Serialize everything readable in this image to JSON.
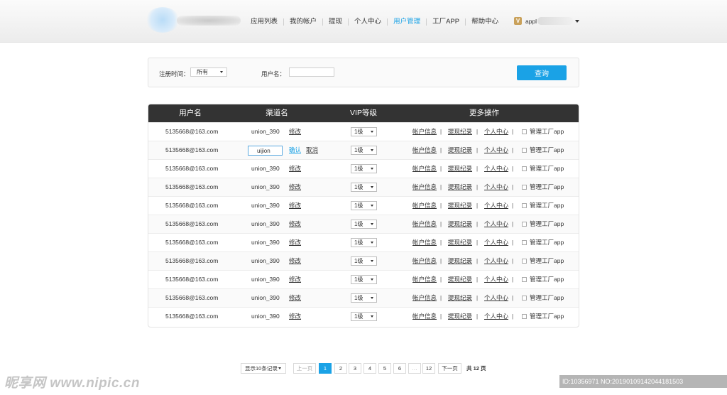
{
  "nav": {
    "items": [
      "应用列表",
      "我的帐户",
      "提现",
      "个人中心",
      "用户管理",
      "工厂APP",
      "帮助中心"
    ],
    "active_index": 4
  },
  "user": {
    "name": "appl"
  },
  "search": {
    "reg_time_label": "注册时间：",
    "reg_time_value": "所有",
    "username_label": "用户名：",
    "username_value": "",
    "query_button": "查询"
  },
  "table": {
    "headers": [
      "用户名",
      "渠道名",
      "VIP等级",
      "更多操作"
    ],
    "rows": [
      {
        "username": "5135668@163.com",
        "channel": "union_390",
        "vip": "1级",
        "editing": false
      },
      {
        "username": "5135668@163.com",
        "channel": "uijion",
        "vip": "1级",
        "editing": true
      },
      {
        "username": "5135668@163.com",
        "channel": "union_390",
        "vip": "1级",
        "editing": false
      },
      {
        "username": "5135668@163.com",
        "channel": "union_390",
        "vip": "1级",
        "editing": false
      },
      {
        "username": "5135668@163.com",
        "channel": "union_390",
        "vip": "1级",
        "editing": false
      },
      {
        "username": "5135668@163.com",
        "channel": "union_390",
        "vip": "1级",
        "editing": false
      },
      {
        "username": "5135668@163.com",
        "channel": "union_390",
        "vip": "1级",
        "editing": false
      },
      {
        "username": "5135668@163.com",
        "channel": "union_390",
        "vip": "1级",
        "editing": false
      },
      {
        "username": "5135668@163.com",
        "channel": "union_390",
        "vip": "1级",
        "editing": false
      },
      {
        "username": "5135668@163.com",
        "channel": "union_390",
        "vip": "1级",
        "editing": false
      },
      {
        "username": "5135668@163.com",
        "channel": "union_390",
        "vip": "1级",
        "editing": false
      }
    ],
    "edit_label": "修改",
    "confirm_label": "确认",
    "cancel_label": "取消",
    "ops": [
      "帐户信息",
      "提现纪录",
      "个人中心"
    ],
    "checkbox_label": "管理工厂app"
  },
  "pagination": {
    "page_size": "显示10条记录",
    "prev": "上一页",
    "pages": [
      "1",
      "2",
      "3",
      "4",
      "5",
      "6",
      "…",
      "12"
    ],
    "active_page": "1",
    "next": "下一页",
    "total": "共 12 页"
  },
  "watermark": {
    "left": "昵享网 www.nipic.cn",
    "right": "ID:10356971 NO:20190109142044181503"
  },
  "colors": {
    "accent": "#1aa2e6",
    "header_dark": "#333333"
  }
}
